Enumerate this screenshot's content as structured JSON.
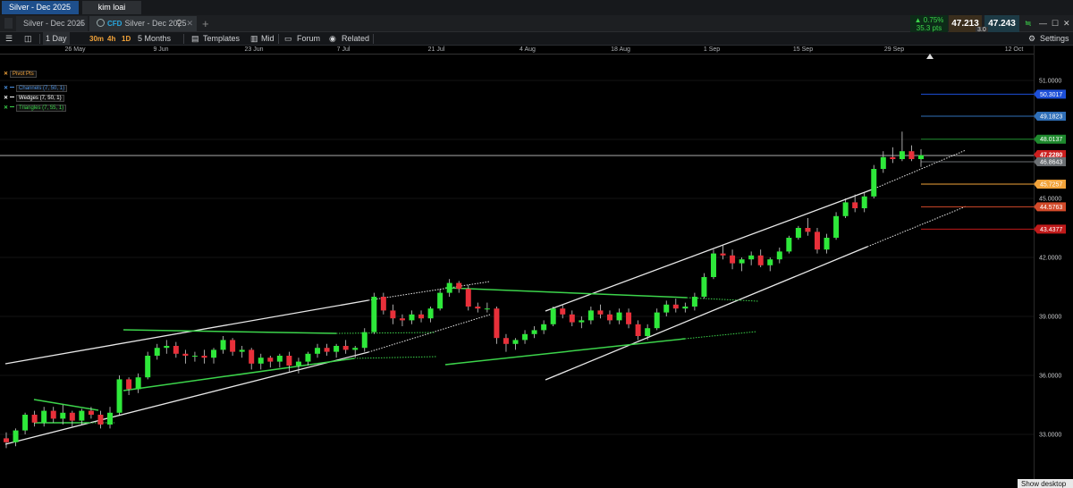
{
  "top_tabs": [
    "Silver - Dec 2025",
    "kim loai"
  ],
  "instrument_tabs": {
    "inactive": "Silver - Dec 2025",
    "active_type": "CFD",
    "active": "Silver - Dec 2025",
    "add": "+"
  },
  "quote": {
    "change_pct": "▲ 0.75%",
    "change_pts": "35.3 pts",
    "bid": "47.213",
    "ask": "47.243",
    "spread": "3.0"
  },
  "toolbar": {
    "interval": "1 Day",
    "quick": [
      "30m",
      "4h",
      "1D"
    ],
    "range": "5 Months",
    "templates": "Templates",
    "price_mode": "Mid",
    "forum": "Forum",
    "related": "Related",
    "settings": "Settings"
  },
  "date_labels": [
    "26 May",
    "9 Jun",
    "23 Jun",
    "7 Jul",
    "21 Jul",
    "4 Aug",
    "18 Aug",
    "1 Sep",
    "15 Sep",
    "29 Sep",
    "12 Oct"
  ],
  "indicators": [
    {
      "label": "Pivot Pts",
      "color": "#f2a33a"
    },
    {
      "label": "Channels (7, 50, 1)",
      "color": "#4a90e2"
    },
    {
      "label": "Wedges (7, 50, 1)",
      "color": "#ffffff"
    },
    {
      "label": "Triangles (7, 55, 1)",
      "color": "#3cd44b"
    }
  ],
  "price_axis": [
    "51.0000",
    "48.0000",
    "45.0000",
    "42.0000",
    "39.0000",
    "36.0000",
    "33.0000"
  ],
  "pivot_levels": [
    {
      "label": "50.3017",
      "color": "#1d4fd8"
    },
    {
      "label": "49.1823",
      "color": "#2f6fb8"
    },
    {
      "label": "48.0137",
      "color": "#1f8a2e"
    },
    {
      "label": "47.2280",
      "color": "#cc1f1f"
    },
    {
      "label": "46.8643",
      "color": "#6b6f73"
    },
    {
      "label": "45.7257",
      "color": "#f2a33a"
    },
    {
      "label": "44.5763",
      "color": "#d24a2a"
    },
    {
      "label": "43.4377",
      "color": "#c01a1a"
    }
  ],
  "colors": {
    "up": "#2ee83a",
    "down": "#e8303a",
    "background": "#000000"
  },
  "chart_data": {
    "type": "candlestick",
    "xlabel": "",
    "ylabel": "",
    "ylim": [
      31.0,
      52.5
    ],
    "x": [
      "26 May",
      "9 Jun",
      "23 Jun",
      "7 Jul",
      "21 Jul",
      "4 Aug",
      "18 Aug",
      "1 Sep",
      "15 Sep",
      "29 Sep",
      "12 Oct"
    ],
    "last_price": 47.228,
    "candles": [
      [
        32.8,
        33.1,
        32.3,
        32.6
      ],
      [
        32.6,
        33.3,
        32.4,
        33.2
      ],
      [
        33.2,
        34.1,
        33.0,
        34.0
      ],
      [
        34.0,
        34.2,
        33.4,
        33.6
      ],
      [
        33.6,
        34.4,
        33.4,
        34.2
      ],
      [
        34.2,
        34.4,
        33.6,
        33.8
      ],
      [
        33.8,
        34.5,
        33.5,
        34.1
      ],
      [
        34.1,
        34.2,
        33.4,
        33.7
      ],
      [
        33.7,
        34.3,
        33.5,
        34.2
      ],
      [
        34.2,
        34.4,
        33.8,
        34.0
      ],
      [
        34.0,
        34.2,
        33.3,
        33.5
      ],
      [
        33.5,
        34.4,
        33.3,
        34.1
      ],
      [
        34.1,
        36.0,
        34.0,
        35.8
      ],
      [
        35.8,
        35.9,
        35.0,
        35.3
      ],
      [
        35.3,
        36.1,
        35.1,
        35.9
      ],
      [
        35.9,
        37.2,
        35.8,
        37.0
      ],
      [
        37.0,
        37.6,
        36.8,
        37.4
      ],
      [
        37.4,
        37.8,
        37.1,
        37.5
      ],
      [
        37.5,
        37.7,
        36.9,
        37.1
      ],
      [
        37.1,
        37.3,
        36.6,
        37.0
      ],
      [
        37.0,
        37.2,
        36.7,
        37.0
      ],
      [
        37.0,
        37.3,
        36.6,
        36.9
      ],
      [
        36.9,
        37.4,
        36.6,
        37.3
      ],
      [
        37.3,
        38.0,
        37.1,
        37.8
      ],
      [
        37.8,
        37.9,
        37.0,
        37.2
      ],
      [
        37.2,
        37.5,
        36.9,
        37.3
      ],
      [
        37.3,
        37.4,
        36.3,
        36.6
      ],
      [
        36.6,
        37.1,
        36.3,
        36.9
      ],
      [
        36.9,
        37.0,
        36.4,
        36.7
      ],
      [
        36.7,
        37.1,
        36.4,
        37.0
      ],
      [
        37.0,
        37.2,
        36.2,
        36.5
      ],
      [
        36.5,
        36.9,
        36.1,
        36.7
      ],
      [
        36.7,
        37.2,
        36.5,
        37.1
      ],
      [
        37.1,
        37.6,
        36.9,
        37.4
      ],
      [
        37.4,
        37.6,
        37.0,
        37.2
      ],
      [
        37.2,
        37.6,
        36.9,
        37.5
      ],
      [
        37.5,
        37.8,
        37.1,
        37.3
      ],
      [
        37.3,
        37.5,
        36.9,
        37.4
      ],
      [
        37.4,
        38.4,
        37.2,
        38.2
      ],
      [
        38.2,
        40.2,
        38.1,
        40.0
      ],
      [
        40.0,
        40.2,
        39.1,
        39.3
      ],
      [
        39.3,
        39.6,
        38.6,
        38.9
      ],
      [
        38.9,
        39.1,
        38.5,
        38.8
      ],
      [
        38.8,
        39.3,
        38.6,
        39.1
      ],
      [
        39.1,
        39.3,
        38.7,
        38.9
      ],
      [
        38.9,
        39.5,
        38.7,
        39.4
      ],
      [
        39.4,
        40.4,
        39.3,
        40.2
      ],
      [
        40.2,
        40.9,
        40.0,
        40.7
      ],
      [
        40.7,
        40.8,
        40.2,
        40.4
      ],
      [
        40.4,
        40.6,
        39.3,
        39.5
      ],
      [
        39.5,
        39.7,
        39.2,
        39.4
      ],
      [
        39.4,
        39.7,
        39.2,
        39.4
      ],
      [
        39.4,
        39.5,
        37.6,
        37.9
      ],
      [
        37.9,
        38.1,
        37.2,
        37.6
      ],
      [
        37.6,
        37.9,
        37.3,
        37.8
      ],
      [
        37.8,
        38.3,
        37.6,
        38.1
      ],
      [
        38.1,
        38.5,
        37.9,
        38.3
      ],
      [
        38.3,
        38.8,
        38.1,
        38.6
      ],
      [
        38.6,
        39.5,
        38.5,
        39.4
      ],
      [
        39.4,
        39.6,
        38.9,
        39.1
      ],
      [
        39.1,
        39.3,
        38.5,
        38.7
      ],
      [
        38.7,
        39.0,
        38.4,
        38.8
      ],
      [
        38.8,
        39.5,
        38.6,
        39.3
      ],
      [
        39.3,
        39.6,
        38.9,
        39.1
      ],
      [
        39.1,
        39.3,
        38.6,
        38.8
      ],
      [
        38.8,
        39.4,
        38.6,
        39.2
      ],
      [
        39.2,
        39.4,
        38.4,
        38.6
      ],
      [
        38.6,
        38.8,
        37.8,
        38.0
      ],
      [
        38.0,
        38.6,
        37.8,
        38.4
      ],
      [
        38.4,
        39.4,
        38.3,
        39.2
      ],
      [
        39.2,
        39.8,
        39.0,
        39.6
      ],
      [
        39.6,
        39.9,
        39.2,
        39.4
      ],
      [
        39.4,
        39.7,
        39.2,
        39.5
      ],
      [
        39.5,
        40.2,
        39.3,
        40.0
      ],
      [
        40.0,
        41.2,
        39.9,
        41.0
      ],
      [
        41.0,
        42.4,
        40.9,
        42.2
      ],
      [
        42.2,
        42.6,
        41.9,
        42.1
      ],
      [
        42.1,
        42.4,
        41.4,
        41.7
      ],
      [
        41.7,
        42.0,
        41.3,
        41.9
      ],
      [
        41.9,
        42.3,
        41.6,
        42.1
      ],
      [
        42.1,
        42.4,
        41.5,
        41.6
      ],
      [
        41.6,
        42.0,
        41.3,
        41.9
      ],
      [
        41.9,
        42.5,
        41.7,
        42.3
      ],
      [
        42.3,
        43.1,
        42.2,
        43.0
      ],
      [
        43.0,
        43.6,
        42.9,
        43.5
      ],
      [
        43.5,
        44.0,
        43.1,
        43.3
      ],
      [
        43.3,
        43.5,
        42.2,
        42.4
      ],
      [
        42.4,
        43.2,
        42.2,
        43.0
      ],
      [
        43.0,
        44.3,
        42.9,
        44.1
      ],
      [
        44.1,
        45.0,
        44.0,
        44.8
      ],
      [
        44.8,
        45.2,
        44.3,
        44.5
      ],
      [
        44.5,
        45.3,
        44.3,
        45.1
      ],
      [
        45.1,
        46.7,
        45.0,
        46.5
      ],
      [
        46.5,
        47.4,
        46.3,
        47.1
      ],
      [
        47.1,
        47.6,
        46.8,
        47.0
      ],
      [
        47.0,
        48.4,
        46.9,
        47.4
      ],
      [
        47.4,
        47.7,
        46.9,
        47.0
      ],
      [
        47.0,
        47.5,
        46.6,
        47.2
      ]
    ]
  }
}
